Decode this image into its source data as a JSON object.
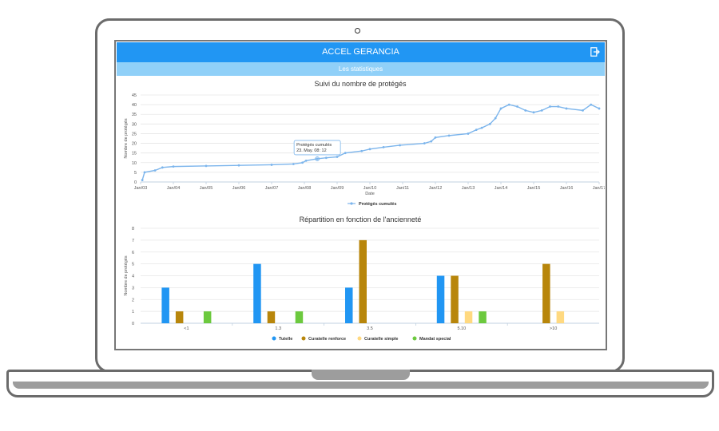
{
  "app": {
    "title": "ACCEL GERANCIA",
    "subtitle": "Les statistiques",
    "header_color": "#2196f3",
    "subheader_color": "#90d0f8",
    "logout_icon": "logout-icon"
  },
  "chart_data": [
    {
      "type": "line",
      "title": "Suivi du nombre de protégés",
      "xlabel": "Date",
      "ylabel": "Nombre de protégés",
      "xlim": [
        "2003-01",
        "2017-01"
      ],
      "ylim": [
        0,
        45
      ],
      "yticks": [
        0,
        5,
        10,
        15,
        20,
        25,
        30,
        35,
        40,
        45
      ],
      "xticks": [
        "Jan/03",
        "Jan/04",
        "Jan/05",
        "Jan/06",
        "Jan/07",
        "Jan/08",
        "Jan/09",
        "Jan/10",
        "Jan/11",
        "Jan/12",
        "Jan/13",
        "Jan/14",
        "Jan/15",
        "Jan/16",
        "Jan/17"
      ],
      "grid": true,
      "legend_position": "bottom",
      "series": [
        {
          "name": "Protégés cumulés",
          "color": "#7cb5ec",
          "points": [
            [
              "2003-01-20",
              1
            ],
            [
              "2003-02-15",
              5
            ],
            [
              "2003-06-10",
              6
            ],
            [
              "2003-09-01",
              7.5
            ],
            [
              "2004-01-01",
              8
            ],
            [
              "2005-01-01",
              8.3
            ],
            [
              "2006-01-01",
              8.6
            ],
            [
              "2007-01-01",
              8.9
            ],
            [
              "2007-09-01",
              9.3
            ],
            [
              "2007-12-10",
              10
            ],
            [
              "2008-01-20",
              11
            ],
            [
              "2008-05-23",
              12
            ],
            [
              "2008-09-01",
              12.5
            ],
            [
              "2009-01-01",
              13
            ],
            [
              "2009-04-01",
              15
            ],
            [
              "2009-10-01",
              16
            ],
            [
              "2010-01-01",
              17
            ],
            [
              "2010-06-01",
              18
            ],
            [
              "2010-12-01",
              19
            ],
            [
              "2011-09-01",
              20
            ],
            [
              "2011-11-15",
              21
            ],
            [
              "2012-01-01",
              23
            ],
            [
              "2012-06-01",
              24
            ],
            [
              "2013-01-01",
              25
            ],
            [
              "2013-04-01",
              27
            ],
            [
              "2013-06-01",
              28
            ],
            [
              "2013-09-01",
              30
            ],
            [
              "2013-11-01",
              33
            ],
            [
              "2014-01-01",
              38
            ],
            [
              "2014-04-01",
              40
            ],
            [
              "2014-07-01",
              39
            ],
            [
              "2014-10-01",
              37
            ],
            [
              "2015-01-01",
              36
            ],
            [
              "2015-04-01",
              37
            ],
            [
              "2015-07-01",
              39
            ],
            [
              "2015-10-01",
              39
            ],
            [
              "2016-01-01",
              38
            ],
            [
              "2016-07-01",
              37
            ],
            [
              "2016-10-01",
              40
            ],
            [
              "2017-01-01",
              38
            ]
          ]
        }
      ],
      "annotations": [
        {
          "text": "Protégés cumulés",
          "subtext": "23. May. 08: 12",
          "x": "2008-05-23",
          "y": 12
        }
      ]
    },
    {
      "type": "bar",
      "title": "Répartition en fonction de l'ancienneté",
      "xlabel": "",
      "ylabel": "Nombre de protégés",
      "ylim": [
        0,
        8
      ],
      "yticks": [
        0,
        1,
        2,
        3,
        4,
        5,
        6,
        7,
        8
      ],
      "categories": [
        "<1",
        "1.3",
        "3.5",
        "5.10",
        ">10"
      ],
      "grid": true,
      "legend_position": "bottom",
      "series": [
        {
          "name": "Tutelle",
          "color": "#2196f3",
          "values": [
            3,
            5,
            3,
            4,
            0
          ]
        },
        {
          "name": "Curatelle renforce",
          "color": "#b8860b",
          "values": [
            1,
            1,
            7,
            4,
            5
          ]
        },
        {
          "name": "Curatelle simple",
          "color": "#ffd980",
          "values": [
            0,
            0,
            0,
            1,
            1
          ]
        },
        {
          "name": "Mandat special",
          "color": "#6cc93e",
          "values": [
            1,
            1,
            0,
            1,
            0
          ]
        }
      ]
    }
  ]
}
